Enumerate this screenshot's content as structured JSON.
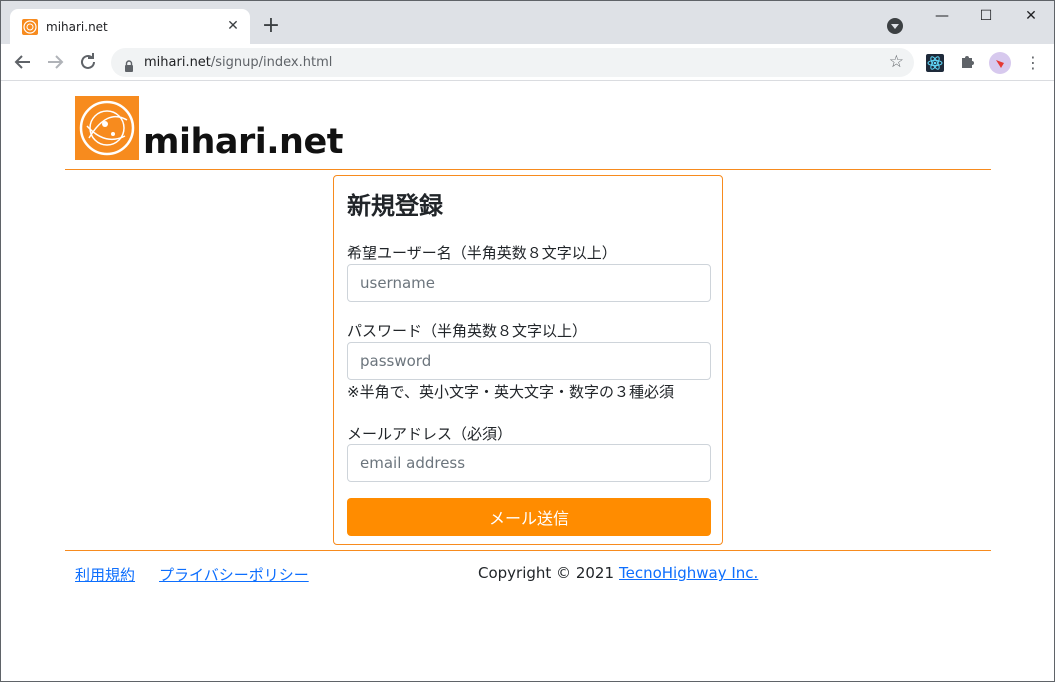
{
  "browser": {
    "tab_title": "mihari.net",
    "tab_close": "✕",
    "new_tab": "+",
    "url_host": "mihari.net",
    "url_path": "/signup/index.html",
    "window_controls": {
      "minimize": "—",
      "maximize": "☐",
      "close": "✕"
    },
    "icons": [
      "back-icon",
      "forward-icon",
      "reload-icon",
      "lock-icon",
      "star-icon",
      "react-extension-icon",
      "puzzle-extension-icon",
      "profile-avatar",
      "menu-icon"
    ]
  },
  "header": {
    "logo_text": "mihari.net"
  },
  "form": {
    "title": "新規登録",
    "username_label": "希望ユーザー名（半角英数８文字以上）",
    "username_placeholder": "username",
    "password_label": "パスワード（半角英数８文字以上）",
    "password_placeholder": "password",
    "password_note": "※半角で、英小文字・英大文字・数字の３種必須",
    "email_label": "メールアドレス（必須）",
    "email_placeholder": "email address",
    "submit_label": "メール送信"
  },
  "footer": {
    "terms_link": "利用規約",
    "privacy_link": "プライバシーポリシー",
    "copyright": "Copyright © 2021",
    "company_link": "TecnoHighway Inc."
  },
  "colors": {
    "accent": "#f78b1e",
    "button": "#ff8c00",
    "link": "#0d6efd"
  }
}
